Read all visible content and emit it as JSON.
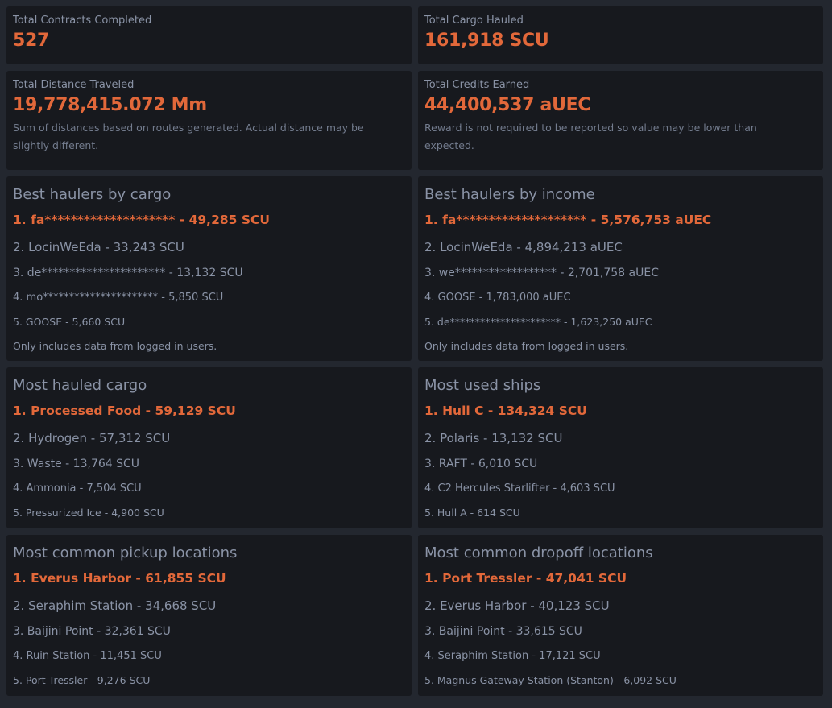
{
  "stats": {
    "contracts": {
      "label": "Total Contracts Completed",
      "value": "527"
    },
    "cargo": {
      "label": "Total Cargo Hauled",
      "value": "161,918 SCU"
    },
    "distance": {
      "label": "Total Distance Traveled",
      "value": "19,778,415.072 Mm",
      "note": "Sum of distances based on routes generated. Actual distance may be slightly different."
    },
    "credits": {
      "label": "Total Credits Earned",
      "value": "44,400,537 aUEC",
      "note": "Reward is not required to be reported so value may be lower than expected."
    }
  },
  "haulers_cargo": {
    "title": "Best haulers by cargo",
    "rows": [
      "1. fa******************** - 49,285 SCU",
      "2. LocinWeEda - 33,243 SCU",
      "3. de********************** - 13,132 SCU",
      "4. mo********************** - 5,850 SCU",
      "5. GOOSE - 5,660 SCU"
    ],
    "footnote": "Only includes data from logged in users."
  },
  "haulers_income": {
    "title": "Best haulers by income",
    "rows": [
      "1. fa******************** - 5,576,753 aUEC",
      "2. LocinWeEda - 4,894,213 aUEC",
      "3. we****************** - 2,701,758 aUEC",
      "4. GOOSE - 1,783,000 aUEC",
      "5. de********************** - 1,623,250 aUEC"
    ],
    "footnote": "Only includes data from logged in users."
  },
  "hauled_cargo": {
    "title": "Most hauled cargo",
    "rows": [
      "1. Processed Food - 59,129 SCU",
      "2. Hydrogen - 57,312 SCU",
      "3. Waste - 13,764 SCU",
      "4. Ammonia - 7,504 SCU",
      "5. Pressurized Ice - 4,900 SCU"
    ]
  },
  "used_ships": {
    "title": "Most used ships",
    "rows": [
      "1. Hull C - 134,324 SCU",
      "2. Polaris - 13,132 SCU",
      "3. RAFT - 6,010 SCU",
      "4. C2 Hercules Starlifter - 4,603 SCU",
      "5. Hull A - 614 SCU"
    ]
  },
  "pickup": {
    "title": "Most common pickup locations",
    "rows": [
      "1. Everus Harbor - 61,855 SCU",
      "2. Seraphim Station - 34,668 SCU",
      "3. Baijini Point - 32,361 SCU",
      "4. Ruin Station - 11,451 SCU",
      "5. Port Tressler - 9,276 SCU"
    ]
  },
  "dropoff": {
    "title": "Most common dropoff locations",
    "rows": [
      "1. Port Tressler - 47,041 SCU",
      "2. Everus Harbor - 40,123 SCU",
      "3. Baijini Point - 33,615 SCU",
      "4. Seraphim Station - 17,121 SCU",
      "5. Magnus Gateway Station (Stanton) - 6,092 SCU"
    ]
  },
  "colors": {
    "accent": "#e2683a",
    "card_bg": "#17191e",
    "page_bg": "#23272f",
    "text_muted": "#8a93a6"
  }
}
